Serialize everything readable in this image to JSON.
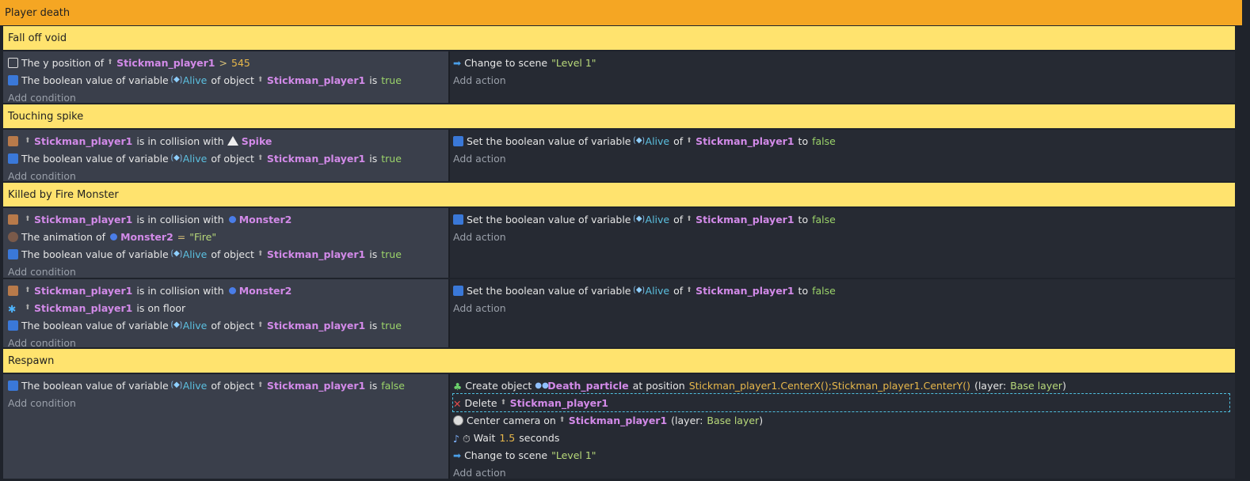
{
  "root_group": {
    "title": "Player death"
  },
  "labels": {
    "add_condition": "Add condition",
    "add_action": "Add action"
  },
  "groups": [
    {
      "title": "Fall off void",
      "events": [
        {
          "conditions": [
            {
              "icon": "checkbox-icon",
              "text": "The y position of",
              "object": "Stickman_player1",
              "op": ">",
              "value": "545"
            },
            {
              "icon": "variable-icon",
              "pre": "The boolean value of variable",
              "var": "Alive",
              "mid": "of object",
              "object": "Stickman_player1",
              "post": "is",
              "bool": "true"
            }
          ],
          "actions": [
            {
              "icon": "scene-icon",
              "text": "Change to scene",
              "str": "\"Level 1\""
            }
          ]
        }
      ]
    },
    {
      "title": "Touching spike",
      "events": [
        {
          "conditions": [
            {
              "icon": "collision-icon",
              "object": "Stickman_player1",
              "text": "is in collision with",
              "target": "Spike"
            },
            {
              "icon": "variable-icon",
              "pre": "The boolean value of variable",
              "var": "Alive",
              "mid": "of object",
              "object": "Stickman_player1",
              "post": "is",
              "bool": "true"
            }
          ],
          "actions": [
            {
              "icon": "variable-icon",
              "pre": "Set the boolean value of variable",
              "var": "Alive",
              "mid": "of",
              "object": "Stickman_player1",
              "post": "to",
              "bool": "false"
            }
          ]
        }
      ]
    },
    {
      "title": "Killed by Fire Monster",
      "events": [
        {
          "conditions": [
            {
              "icon": "collision-icon",
              "object": "Stickman_player1",
              "text": "is in collision with",
              "target": "Monster2"
            },
            {
              "icon": "animation-icon",
              "text": "The animation of",
              "target": "Monster2",
              "op": "=",
              "str": "\"Fire\""
            },
            {
              "icon": "variable-icon",
              "pre": "The boolean value of variable",
              "var": "Alive",
              "mid": "of object",
              "object": "Stickman_player1",
              "post": "is",
              "bool": "true"
            }
          ],
          "actions": [
            {
              "icon": "variable-icon",
              "pre": "Set the boolean value of variable",
              "var": "Alive",
              "mid": "of",
              "object": "Stickman_player1",
              "post": "to",
              "bool": "false"
            }
          ]
        },
        {
          "conditions": [
            {
              "icon": "collision-icon",
              "object": "Stickman_player1",
              "text": "is in collision with",
              "target": "Monster2"
            },
            {
              "icon": "floor-icon",
              "object": "Stickman_player1",
              "text": "is on floor"
            },
            {
              "icon": "variable-icon",
              "pre": "The boolean value of variable",
              "var": "Alive",
              "mid": "of object",
              "object": "Stickman_player1",
              "post": "is",
              "bool": "true"
            }
          ],
          "actions": [
            {
              "icon": "variable-icon",
              "pre": "Set the boolean value of variable",
              "var": "Alive",
              "mid": "of",
              "object": "Stickman_player1",
              "post": "to",
              "bool": "false"
            }
          ]
        }
      ]
    },
    {
      "title": "Respawn",
      "events": [
        {
          "conditions": [
            {
              "icon": "variable-icon",
              "pre": "The boolean value of variable",
              "var": "Alive",
              "mid": "of object",
              "object": "Stickman_player1",
              "post": "is",
              "bool": "false"
            }
          ],
          "actions": [
            {
              "icon": "create-icon",
              "pre": "Create object",
              "target": "Death_particle",
              "mid": "at position",
              "expr": "Stickman_player1.CenterX();Stickman_player1.CenterY()",
              "layer_pre": "(layer:",
              "layer": "Base layer",
              "layer_post": ")"
            },
            {
              "icon": "delete-icon",
              "pre": "Delete",
              "object": "Stickman_player1"
            },
            {
              "icon": "camera-icon",
              "pre": "Center camera on",
              "object": "Stickman_player1",
              "layer_pre": "(layer:",
              "layer": "Base layer",
              "layer_post": ")"
            },
            {
              "icon": "wait-icon",
              "pre": "Wait",
              "num": "1.5",
              "post": "seconds"
            },
            {
              "icon": "scene-icon",
              "text": "Change to scene",
              "str": "\"Level 1\""
            }
          ]
        }
      ]
    }
  ]
}
